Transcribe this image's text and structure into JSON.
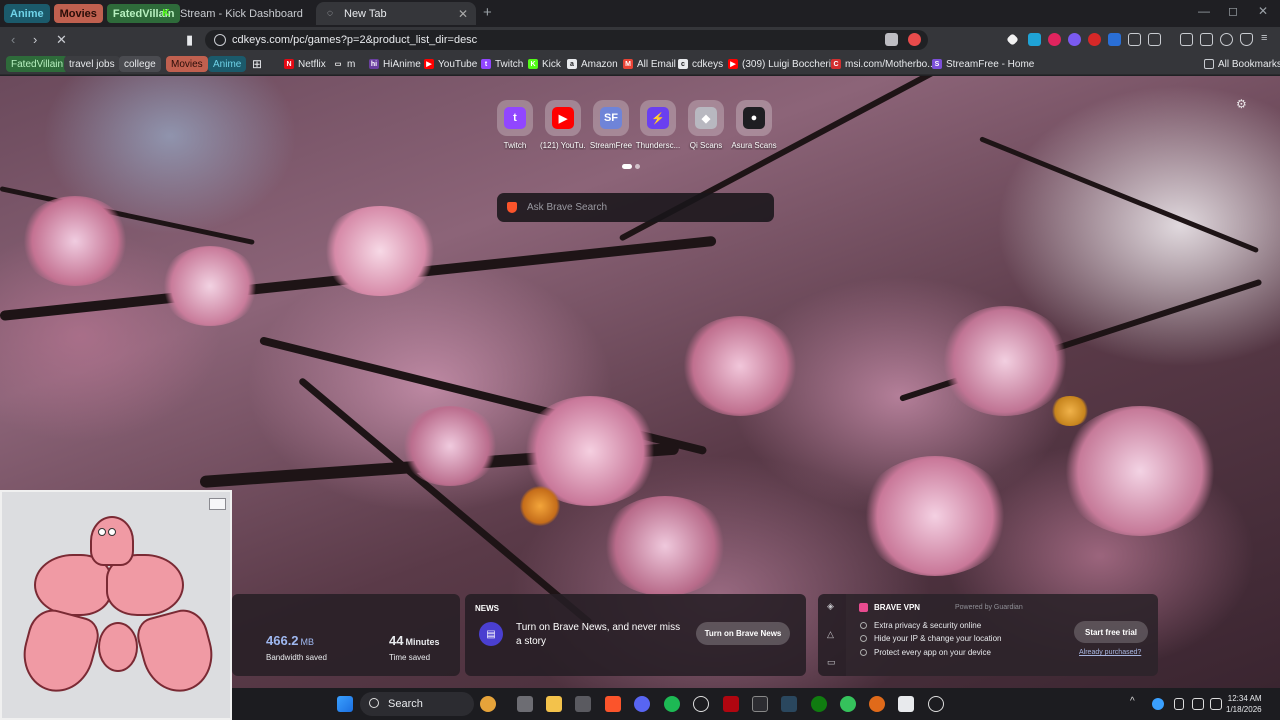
{
  "tab_groups": [
    {
      "label": "Anime",
      "bg": "#1b5a6b",
      "fg": "#6fd3e8"
    },
    {
      "label": "Movies",
      "bg": "#c0604f",
      "fg": "#2a0d08"
    },
    {
      "label": "FatedVillain",
      "bg": "#2e6b3a",
      "fg": "#b7f0bf"
    }
  ],
  "tabs": [
    {
      "title": "Stream - Kick Dashboard",
      "icon": "kick-icon"
    },
    {
      "title": "New Tab",
      "icon": "loading-spinner-icon",
      "close": "✕"
    }
  ],
  "new_tab_symbol": "+",
  "window_controls": [
    "—",
    "◻",
    "✕"
  ],
  "toolbar": {
    "back": "‹",
    "forward": "›",
    "reload": "✕",
    "url": "cdkeys.com/pc/games?p=2&product_list_dir=desc"
  },
  "bookmark_groups": [
    {
      "label": "FatedVillain",
      "bg": "#2e6b3a",
      "fg": "#b7f0bf"
    },
    {
      "label": "travel jobs",
      "bg": "#3c3d41",
      "fg": "#e8eaed"
    },
    {
      "label": "college",
      "bg": "#4a4b50",
      "fg": "#e8eaed"
    },
    {
      "label": "Movies",
      "bg": "#c0604f",
      "fg": "#2a0d08"
    },
    {
      "label": "Anime",
      "bg": "#1b5a6b",
      "fg": "#6fd3e8"
    }
  ],
  "bookmarks": [
    {
      "label": "Netflix",
      "icon": "netflix-icon",
      "color": "#e50914",
      "glyph": "N"
    },
    {
      "label": "m",
      "icon": "folder-icon",
      "color": "#35363a",
      "glyph": "▭"
    },
    {
      "label": "HiAnime",
      "icon": "hianime-icon",
      "color": "#6a3fa0",
      "glyph": "hi"
    },
    {
      "label": "YouTube",
      "icon": "youtube-icon",
      "color": "#ff0000",
      "glyph": "▶"
    },
    {
      "label": "Twitch",
      "icon": "twitch-icon",
      "color": "#9146ff",
      "glyph": "t"
    },
    {
      "label": "Kick",
      "icon": "kick-icon",
      "color": "#53fc18",
      "glyph": "K"
    },
    {
      "label": "Amazon",
      "icon": "amazon-icon",
      "color": "#e8eaed",
      "glyph": "a"
    },
    {
      "label": "All Email",
      "icon": "gmail-icon",
      "color": "#ea4335",
      "glyph": "M"
    },
    {
      "label": "cdkeys",
      "icon": "cdkeys-icon",
      "color": "#e8eaed",
      "glyph": "c"
    },
    {
      "label": "(309) Luigi Boccheri...",
      "icon": "youtube-icon",
      "color": "#ff0000",
      "glyph": "▶"
    },
    {
      "label": "msi.com/Motherbo...",
      "icon": "msi-icon",
      "color": "#d32f2f",
      "glyph": "C"
    },
    {
      "label": "StreamFree - Home",
      "icon": "streamfree-icon",
      "color": "#7b4fd8",
      "glyph": "S"
    }
  ],
  "all_bookmarks": "All Bookmarks",
  "top_sites": [
    {
      "label": "Twitch",
      "icon": "twitch-icon",
      "color": "#9146ff",
      "glyph": "t"
    },
    {
      "label": "(121) YouTu...",
      "icon": "youtube-icon",
      "color": "#ff0000",
      "glyph": "▶"
    },
    {
      "label": "StreamFree",
      "icon": "streamfree-icon",
      "color": "#6f84d8",
      "glyph": "SF"
    },
    {
      "label": "Thundersc...",
      "icon": "thunderscans-icon",
      "color": "#6a3ff0",
      "glyph": "⚡"
    },
    {
      "label": "Qi Scans",
      "icon": "qiscans-icon",
      "color": "#b8b8c0",
      "glyph": "◆"
    },
    {
      "label": "Asura Scans",
      "icon": "asura-icon",
      "color": "#1e1e22",
      "glyph": "●"
    }
  ],
  "search": {
    "placeholder": "Ask Brave Search"
  },
  "stats": {
    "bandwidth_value": "466.2",
    "bandwidth_unit": "MB",
    "bandwidth_label": "Bandwidth saved",
    "time_value": "44",
    "time_unit": "Minutes",
    "time_label": "Time saved"
  },
  "news": {
    "title": "NEWS",
    "message": "Turn on Brave News, and never miss a story",
    "button": "Turn on Brave News"
  },
  "vpn": {
    "title": "BRAVE VPN",
    "powered": "Powered by  Guardian",
    "features": [
      "Extra privacy & security online",
      "Hide your IP & change your location",
      "Protect every app on your device"
    ],
    "trial_button": "Start free trial",
    "purchased_link": "Already purchased?"
  },
  "taskbar": {
    "search_label": "Search",
    "time": "12:34 AM",
    "date": "1/18/2026"
  }
}
